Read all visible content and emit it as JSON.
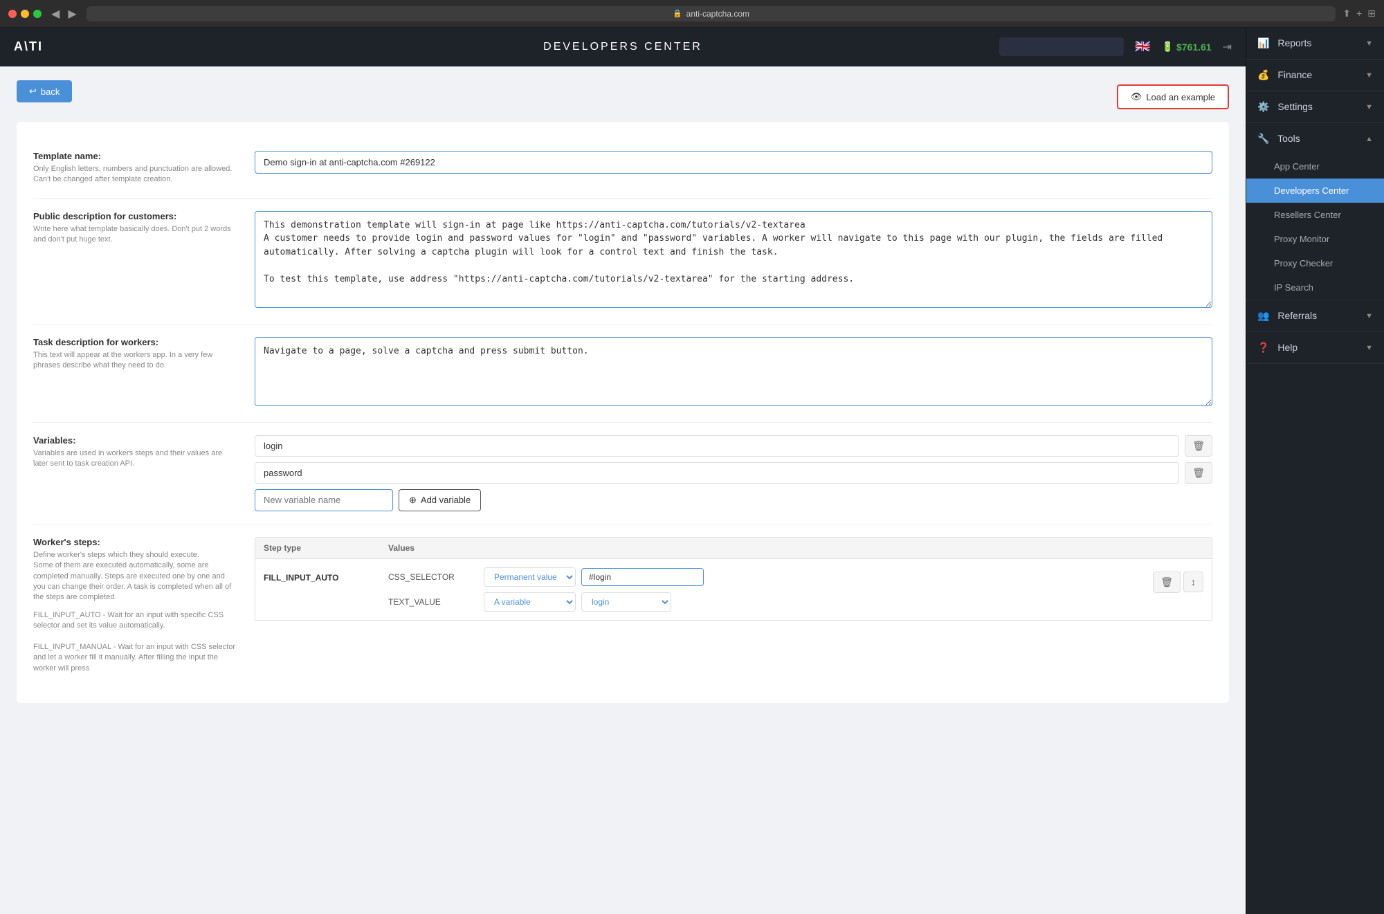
{
  "browser": {
    "url": "anti-captcha.com",
    "lock_symbol": "🔒"
  },
  "header": {
    "logo": "A\\TI",
    "title": "DEVELOPERS CENTER",
    "search_placeholder": "",
    "balance": "$761.61",
    "flag": "🇬🇧"
  },
  "back_button": "back",
  "load_example_button": "Load an example",
  "form": {
    "template_name": {
      "label": "Template name:",
      "description": "Only English letters, numbers and punctuation are allowed. Can't be changed after template creation.",
      "value": "Demo sign-in at anti-captcha.com #269122"
    },
    "public_description": {
      "label": "Public description for customers:",
      "description": "Write here what template basically does. Don't put 2 words and don't put huge text.",
      "value": "This demonstration template will sign-in at page like https://anti-captcha.com/tutorials/v2-textarea\nA customer needs to provide login and password values for \"login\" and \"password\" variables. A worker will navigate to this page with our plugin, the fields are filled automatically. After solving a captcha plugin will look for a control text and finish the task.\n\nTo test this template, use address \"https://anti-captcha.com/tutorials/v2-textarea\" for the starting address."
    },
    "task_description": {
      "label": "Task description for workers:",
      "description": "This text will appear at the workers app. In a very few phrases describe what they need to do.",
      "value": "Navigate to a page, solve a captcha and press submit button."
    },
    "variables": {
      "label": "Variables:",
      "description": "Variables are used in workers steps and their values are later sent to task creation API.",
      "items": [
        "login",
        "password"
      ],
      "new_placeholder": "New variable name",
      "add_button": "Add variable"
    },
    "workers_steps": {
      "label": "Worker's steps:",
      "description": "Define worker's steps which they should execute.\nSome of them are executed automatically, some are completed manually. Steps are executed one by one and you can change their order. A task is completed when all of the steps are completed.",
      "extra_desc": "FILL_INPUT_AUTO - Wait for an input with specific CSS selector and set its value automatically.\n\nFILL_INPUT_MANUAL - Wait for an input with CSS selector and let a worker fill it manually. After filling the input the worker will press",
      "table": {
        "col_step": "Step type",
        "col_values": "Values",
        "rows": [
          {
            "type": "FILL_INPUT_AUTO",
            "values": [
              {
                "key": "CSS_SELECTOR",
                "select_value": "Permanent value",
                "text_value": "#login"
              },
              {
                "key": "TEXT_VALUE",
                "select_value": "A variable",
                "text_value": "login"
              }
            ]
          }
        ]
      }
    }
  },
  "sidebar": {
    "sections": [
      {
        "id": "reports",
        "label": "Reports",
        "icon": "📊",
        "expanded": false,
        "items": []
      },
      {
        "id": "finance",
        "label": "Finance",
        "icon": "💰",
        "expanded": false,
        "items": []
      },
      {
        "id": "settings",
        "label": "Settings",
        "icon": "⚙️",
        "expanded": false,
        "items": []
      },
      {
        "id": "tools",
        "label": "Tools",
        "icon": "🔧",
        "expanded": true,
        "items": [
          {
            "id": "app-center",
            "label": "App Center",
            "active": false
          },
          {
            "id": "developers-center",
            "label": "Developers Center",
            "active": true
          },
          {
            "id": "resellers-center",
            "label": "Resellers Center",
            "active": false
          },
          {
            "id": "proxy-monitor",
            "label": "Proxy Monitor",
            "active": false
          },
          {
            "id": "proxy-checker",
            "label": "Proxy Checker",
            "active": false
          },
          {
            "id": "ip-search",
            "label": "IP Search",
            "active": false
          }
        ]
      },
      {
        "id": "referrals",
        "label": "Referrals",
        "icon": "👥",
        "expanded": false,
        "items": []
      },
      {
        "id": "help",
        "label": "Help",
        "icon": "❓",
        "expanded": false,
        "items": []
      }
    ]
  }
}
